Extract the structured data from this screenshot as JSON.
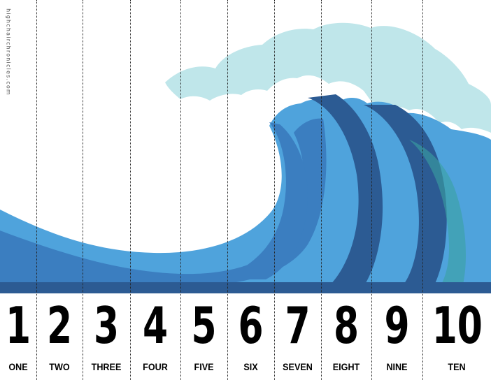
{
  "watermark": "highchairchronicles.com",
  "colors": {
    "foam": "#bfe6ea",
    "wave_light": "#4fa3dc",
    "wave_mid": "#3b7ec0",
    "wave_dark": "#2c5b93",
    "teal": "#3aa1a0"
  },
  "strips": [
    {
      "number": "1",
      "word": "ONE"
    },
    {
      "number": "2",
      "word": "TWO"
    },
    {
      "number": "3",
      "word": "THREE"
    },
    {
      "number": "4",
      "word": "FOUR"
    },
    {
      "number": "5",
      "word": "FIVE"
    },
    {
      "number": "6",
      "word": "SIX"
    },
    {
      "number": "7",
      "word": "SEVEN"
    },
    {
      "number": "8",
      "word": "EIGHT"
    },
    {
      "number": "9",
      "word": "NINE"
    },
    {
      "number": "10",
      "word": "TEN"
    }
  ]
}
